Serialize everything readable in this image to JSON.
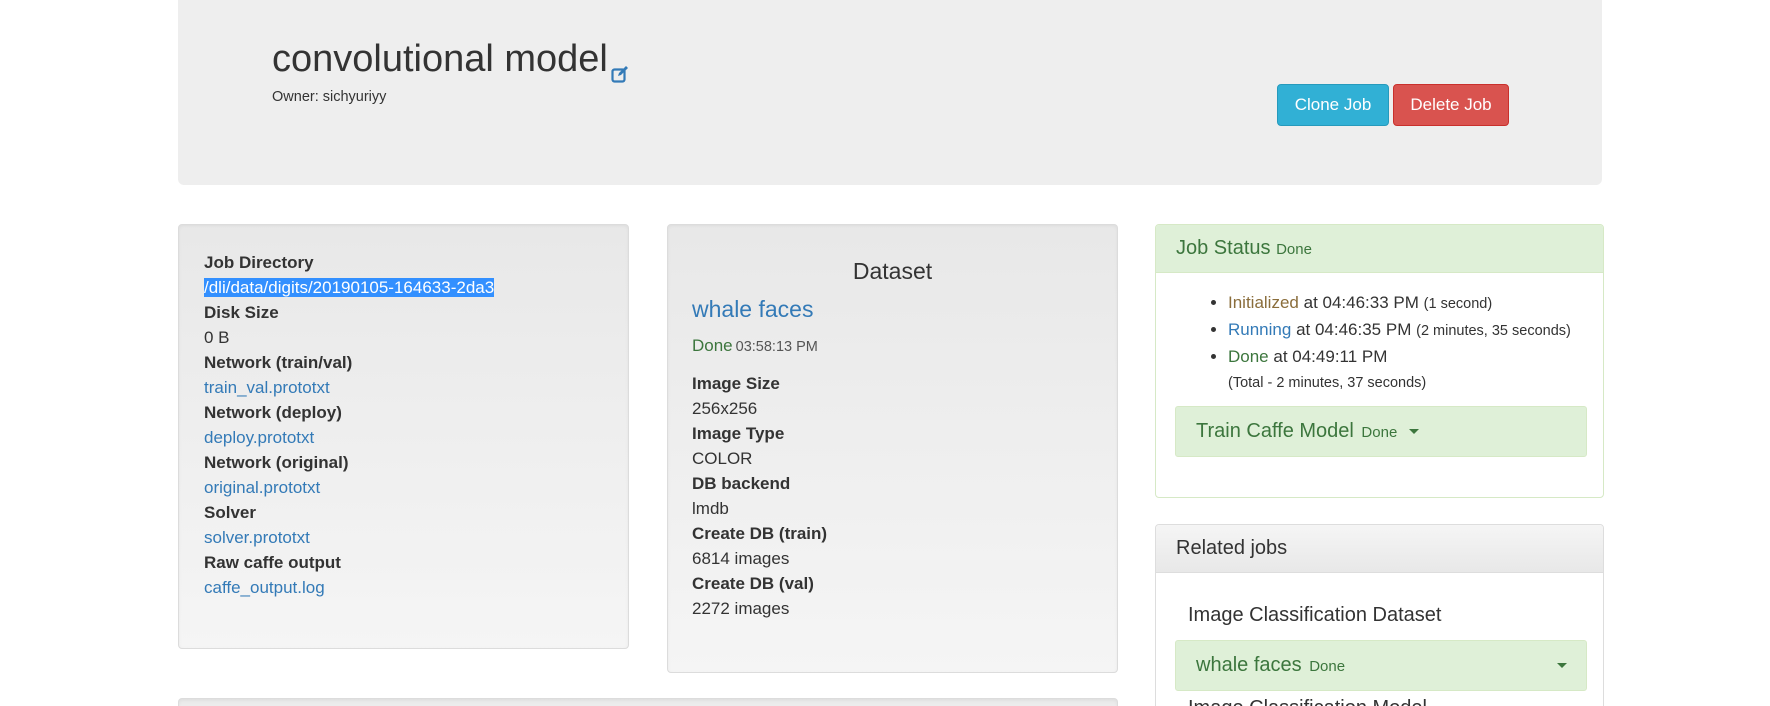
{
  "header": {
    "title": "convolutional model",
    "owner_label": "Owner:",
    "owner_name": "sichyuriyy",
    "clone_label": "Clone Job",
    "delete_label": "Delete Job"
  },
  "job_info": {
    "job_directory_label": "Job Directory",
    "job_directory_value": "/dli/data/digits/20190105-164633-2da3",
    "disk_size_label": "Disk Size",
    "disk_size_value": "0 B",
    "network_trainval_label": "Network (train/val)",
    "network_trainval_link": "train_val.prototxt",
    "network_deploy_label": "Network (deploy)",
    "network_deploy_link": "deploy.prototxt",
    "network_original_label": "Network (original)",
    "network_original_link": "original.prototxt",
    "solver_label": "Solver",
    "solver_link": "solver.prototxt",
    "raw_output_label": "Raw caffe output",
    "raw_output_link": "caffe_output.log"
  },
  "dataset": {
    "heading": "Dataset",
    "name": "whale faces",
    "status": "Done",
    "status_time": "03:58:13 PM",
    "image_size_label": "Image Size",
    "image_size_value": "256x256",
    "image_type_label": "Image Type",
    "image_type_value": "COLOR",
    "db_backend_label": "DB backend",
    "db_backend_value": "lmdb",
    "create_train_label": "Create DB (train)",
    "create_train_value": "6814 images",
    "create_val_label": "Create DB (val)",
    "create_val_value": "2272 images"
  },
  "job_status": {
    "title": "Job Status",
    "state": "Done",
    "events": [
      {
        "state": "Initialized",
        "at": "at 04:46:33 PM",
        "duration": "(1 second)"
      },
      {
        "state": "Running",
        "at": "at 04:46:35 PM",
        "duration": "(2 minutes, 35 seconds)"
      },
      {
        "state": "Done",
        "at": "at 04:49:11 PM",
        "duration": ""
      }
    ],
    "total": "(Total - 2 minutes, 37 seconds)",
    "task_label": "Train Caffe Model",
    "task_state": "Done"
  },
  "related": {
    "title": "Related jobs",
    "type_label": "Image Classification Dataset",
    "job_name": "whale faces",
    "job_state": "Done",
    "next_label": "Image Classification Model"
  },
  "colors": {
    "accent_link": "#337ab7",
    "success_bg": "#dff0d8",
    "success_text": "#3c763d",
    "info_button": "#31b0d5",
    "danger_button": "#d9534f"
  }
}
